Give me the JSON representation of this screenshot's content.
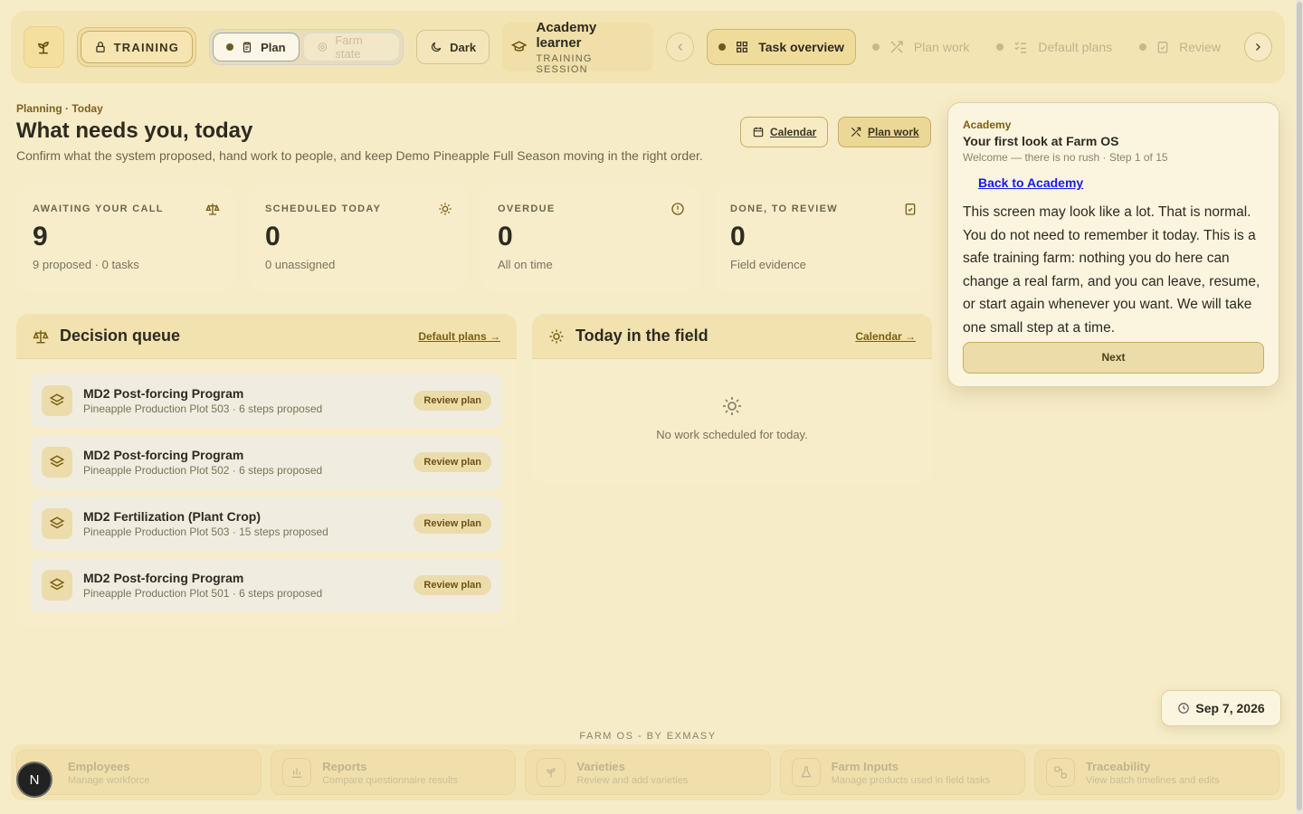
{
  "topbar": {
    "training_label": "TRAINING",
    "modes": [
      {
        "label": "Plan"
      },
      {
        "label": "Farm state"
      }
    ],
    "theme_label": "Dark",
    "learner_name": "Academy learner",
    "learner_session": "TRAINING SESSION",
    "tabs": [
      {
        "label": "Task overview",
        "icon": "grid-icon"
      },
      {
        "label": "Plan work",
        "icon": "tools-icon"
      },
      {
        "label": "Default plans",
        "icon": "list-check-icon"
      },
      {
        "label": "Review",
        "icon": "clipboard-check-icon"
      }
    ]
  },
  "header": {
    "breadcrumb": "Planning · Today",
    "title": "What needs you, today",
    "subtitle": "Confirm what the system proposed, hand work to people, and keep Demo Pineapple Full Season moving in the right order.",
    "calendar_button": "Calendar",
    "plan_button": "Plan work"
  },
  "stats": [
    {
      "label": "AWAITING YOUR CALL",
      "value": "9",
      "note": "9 proposed · 0 tasks",
      "icon": "scale-icon"
    },
    {
      "label": "SCHEDULED TODAY",
      "value": "0",
      "note": "0 unassigned",
      "icon": "sun-icon"
    },
    {
      "label": "OVERDUE",
      "value": "0",
      "note": "All on time",
      "icon": "alert-circle-icon"
    },
    {
      "label": "DONE, TO REVIEW",
      "value": "0",
      "note": "Field evidence",
      "icon": "clipboard-check-icon"
    }
  ],
  "decision_queue": {
    "title": "Decision queue",
    "link": "Default plans →",
    "items": [
      {
        "title": "MD2 Post-forcing Program",
        "sub": "Pineapple Production Plot 503 · 6 steps proposed",
        "action": "Review plan"
      },
      {
        "title": "MD2 Post-forcing Program",
        "sub": "Pineapple Production Plot 502 · 6 steps proposed",
        "action": "Review plan"
      },
      {
        "title": "MD2 Fertilization (Plant Crop)",
        "sub": "Pineapple Production Plot 503 · 15 steps proposed",
        "action": "Review plan"
      },
      {
        "title": "MD2 Post-forcing Program",
        "sub": "Pineapple Production Plot 501 · 6 steps proposed",
        "action": "Review plan"
      }
    ]
  },
  "field": {
    "title": "Today in the field",
    "link": "Calendar →",
    "empty_text": "No work scheduled for today."
  },
  "coach": {
    "kicker": "Academy",
    "title": "Your first look at Farm OS",
    "meta": "Welcome — there is no rush · Step 1 of 15",
    "link": "Back to Academy",
    "body": "This screen may look like a lot. That is normal. You do not need to remember it today. This is a safe training farm: nothing you do here can change a real farm, and you can leave, resume, or start again whenever you want. We will take one small step at a time.",
    "next": "Next"
  },
  "date": {
    "icon": "clock-icon",
    "text": "Sep 7, 2026"
  },
  "footer": {
    "label": "FARM OS - BY EXMASY",
    "items": [
      {
        "title": "Employees",
        "sub": "Manage workforce"
      },
      {
        "title": "Reports",
        "sub": "Compare questionnaire results"
      },
      {
        "title": "Varieties",
        "sub": "Review and add varieties"
      },
      {
        "title": "Farm Inputs",
        "sub": "Manage products used in field tasks"
      },
      {
        "title": "Traceability",
        "sub": "View batch timelines and edits"
      }
    ],
    "avatar_initial": "N"
  }
}
